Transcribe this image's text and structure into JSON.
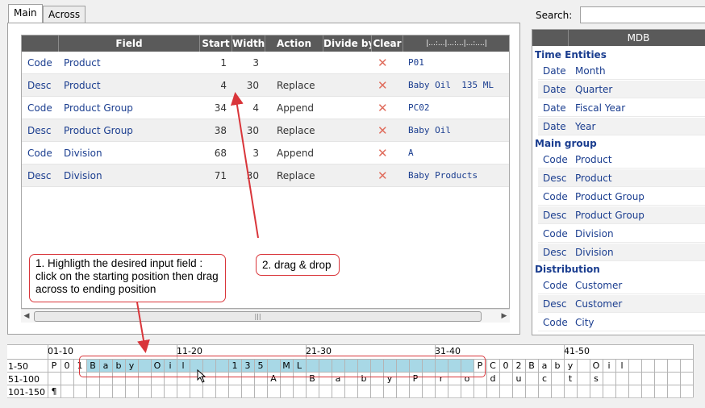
{
  "tabs": [
    {
      "label": "Main"
    },
    {
      "label": "Across"
    }
  ],
  "search": {
    "label": "Search:",
    "value": ""
  },
  "grid": {
    "headers": {
      "field": "Field",
      "start": "Start",
      "width": "Width",
      "action": "Action",
      "divide_by": "Divide by",
      "clear": "Clear",
      "ruler": "|...:...|...:...|...:....|"
    },
    "clear_glyph": "✕",
    "rows": [
      {
        "kind": "Code",
        "field": "Product",
        "start": "1",
        "width": "3",
        "action": "",
        "sample": "P01"
      },
      {
        "kind": "Desc",
        "field": "Product",
        "start": "4",
        "width": "30",
        "action": "Replace",
        "sample": "Baby Oil  135 ML"
      },
      {
        "kind": "Code",
        "field": "Product Group",
        "start": "34",
        "width": "4",
        "action": "Append",
        "sample": "PC02"
      },
      {
        "kind": "Desc",
        "field": "Product Group",
        "start": "38",
        "width": "30",
        "action": "Replace",
        "sample": "Baby Oil"
      },
      {
        "kind": "Code",
        "field": "Division",
        "start": "68",
        "width": "3",
        "action": "Append",
        "sample": "A"
      },
      {
        "kind": "Desc",
        "field": "Division",
        "start": "71",
        "width": "30",
        "action": "Replace",
        "sample": "Baby Products"
      }
    ]
  },
  "scrollbar": {
    "left_arrow": "◀",
    "right_arrow": "▶",
    "grip": "|||"
  },
  "mdb": {
    "header": "MDB",
    "groups": [
      {
        "name": "Time Entities",
        "items": [
          {
            "k": "Date",
            "v": "Month"
          },
          {
            "k": "Date",
            "v": "Quarter"
          },
          {
            "k": "Date",
            "v": "Fiscal Year"
          },
          {
            "k": "Date",
            "v": "Year"
          }
        ]
      },
      {
        "name": "Main group",
        "items": [
          {
            "k": "Code",
            "v": "Product"
          },
          {
            "k": "Desc",
            "v": "Product"
          },
          {
            "k": "Code",
            "v": "Product Group"
          },
          {
            "k": "Desc",
            "v": "Product Group"
          },
          {
            "k": "Code",
            "v": "Division"
          },
          {
            "k": "Desc",
            "v": "Division"
          }
        ]
      },
      {
        "name": "Distribution",
        "items": [
          {
            "k": "Code",
            "v": "Customer"
          },
          {
            "k": "Desc",
            "v": "Customer"
          },
          {
            "k": "Code",
            "v": "City"
          }
        ]
      }
    ]
  },
  "ruler": {
    "columns": [
      "01-10",
      "11-20",
      "21-30",
      "31-40",
      "41-50"
    ],
    "row_labels": [
      "1-50",
      "51-100",
      "101-150"
    ],
    "row1_chars": [
      "P",
      "0",
      "1",
      "B",
      "a",
      "b",
      "y",
      "",
      "O",
      "i",
      "l",
      "",
      "",
      "",
      "1",
      "3",
      "5",
      "",
      "M",
      "L",
      "",
      "",
      "",
      "",
      "",
      "",
      "",
      "",
      "",
      "",
      "",
      "",
      "",
      "P",
      "C",
      "0",
      "2",
      "B",
      "a",
      "b",
      "y",
      "",
      "O",
      "i",
      "l"
    ],
    "row2_chars": [
      "",
      "",
      "",
      "",
      "",
      "",
      "",
      "",
      "",
      "",
      "",
      "",
      "",
      "",
      "",
      "",
      "",
      "A",
      "",
      "",
      "B",
      "",
      "a",
      "",
      "b",
      "",
      "y",
      "",
      "P",
      "",
      "r",
      "",
      "o",
      "",
      "d",
      "",
      "u",
      "",
      "c",
      "",
      "t",
      "",
      "s"
    ],
    "row3_chars": [
      "¶"
    ]
  },
  "annotations": {
    "step1": "1. Highligth the desired input field : click on the starting position then drag across to ending position",
    "step2": "2. drag & drop"
  },
  "colors": {
    "highlight": "#a8d8e6",
    "annotation": "#d9353a",
    "header": "#5a5a5a",
    "link_text": "#1a3d8f"
  }
}
